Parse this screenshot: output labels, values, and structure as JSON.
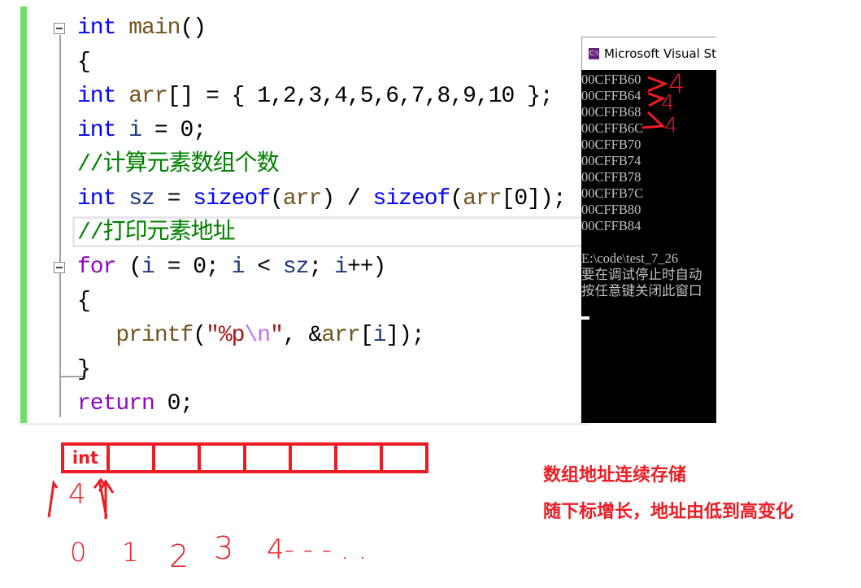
{
  "editor": {
    "lines": [
      [
        [
          "int",
          "kw"
        ],
        [
          " ",
          "tx"
        ],
        [
          "main",
          "id"
        ],
        [
          "()",
          "tx"
        ]
      ],
      [
        [
          "{",
          "tx"
        ]
      ],
      [
        [
          "int",
          "kw"
        ],
        [
          " ",
          "tx"
        ],
        [
          "arr",
          "id"
        ],
        [
          "[] = { 1,2,3,4,5,6,7,8,9,10 };",
          "tx"
        ]
      ],
      [
        [
          "int",
          "kw"
        ],
        [
          " ",
          "tx"
        ],
        [
          "i",
          "vr"
        ],
        [
          " = 0;",
          "tx"
        ]
      ],
      [
        [
          "//计算元素数组个数",
          "cm"
        ]
      ],
      [
        [
          "int",
          "kw"
        ],
        [
          " ",
          "tx"
        ],
        [
          "sz",
          "vr"
        ],
        [
          " = ",
          "tx"
        ],
        [
          "sizeof",
          "kw"
        ],
        [
          "(",
          "tx"
        ],
        [
          "arr",
          "id"
        ],
        [
          ") / ",
          "tx"
        ],
        [
          "sizeof",
          "kw"
        ],
        [
          "(",
          "tx"
        ],
        [
          "arr",
          "id"
        ],
        [
          "[0]);",
          "tx"
        ]
      ],
      [
        [
          "//打印元素地址",
          "cm"
        ]
      ],
      [
        [
          "for",
          "fl"
        ],
        [
          " (",
          "tx"
        ],
        [
          "i",
          "vr"
        ],
        [
          " = 0; ",
          "tx"
        ],
        [
          "i",
          "vr"
        ],
        [
          " < ",
          "tx"
        ],
        [
          "sz",
          "vr"
        ],
        [
          "; ",
          "tx"
        ],
        [
          "i",
          "vr"
        ],
        [
          "++)",
          "tx"
        ]
      ],
      [
        [
          "{",
          "tx"
        ]
      ],
      [
        [
          "   ",
          "tx"
        ],
        [
          "printf",
          "id"
        ],
        [
          "(",
          "tx"
        ],
        [
          "\"%p",
          "st"
        ],
        [
          "\\n",
          "es"
        ],
        [
          "\"",
          "st"
        ],
        [
          ", &",
          "tx"
        ],
        [
          "arr",
          "id"
        ],
        [
          "[",
          "tx"
        ],
        [
          "i",
          "vr"
        ],
        [
          "]);",
          "tx"
        ]
      ],
      [
        [
          "}",
          "tx"
        ]
      ],
      [
        [
          "return",
          "fl"
        ],
        [
          " 0;",
          "tx"
        ]
      ]
    ]
  },
  "console": {
    "title": "Microsoft Visual St",
    "icon": "console-app-icon",
    "output": [
      "00CFFB60",
      "00CFFB64",
      "00CFFB68",
      "00CFFB6C",
      "00CFFB70",
      "00CFFB74",
      "00CFFB78",
      "00CFFB7C",
      "00CFFB80",
      "00CFFB84",
      "",
      "E:\\code\\test_7_26",
      "要在调试停止时自动",
      "按任意键关闭此窗口"
    ]
  },
  "annotations": {
    "console_diffs": [
      "4",
      "4",
      "4"
    ],
    "cell_label": "int",
    "cell_count": 8,
    "size_label": "4",
    "indices": [
      "0",
      "1",
      "2",
      "3",
      "4- - - . ."
    ],
    "note1": "数组地址连续存储",
    "note2": "随下标增长，地址由低到高变化",
    "color": "#ed1c24"
  }
}
